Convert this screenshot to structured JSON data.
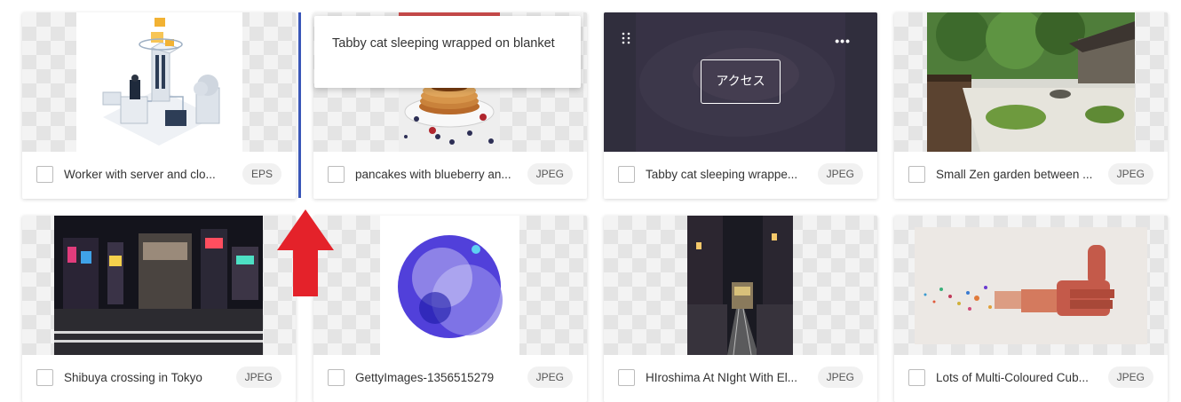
{
  "tooltip": {
    "text": "Tabby cat sleeping wrapped on blanket"
  },
  "hover": {
    "access_label": "アクセス",
    "more_glyph": "•••"
  },
  "cards": [
    {
      "title": "Worker with server and clo...",
      "format": "EPS"
    },
    {
      "title": "pancakes with blueberry an...",
      "format": "JPEG"
    },
    {
      "title": "Tabby cat sleeping wrappe...",
      "format": "JPEG"
    },
    {
      "title": "Small Zen garden between ...",
      "format": "JPEG"
    },
    {
      "title": "Shibuya crossing in Tokyo",
      "format": "JPEG"
    },
    {
      "title": "GettyImages-1356515279",
      "format": "JPEG"
    },
    {
      "title": "HIroshima At NIght With El...",
      "format": "JPEG"
    },
    {
      "title": "Lots of Multi-Coloured Cub...",
      "format": "JPEG"
    }
  ],
  "colors": {
    "drop_indicator": "#3a56b8",
    "arrow": "#e4222a"
  }
}
